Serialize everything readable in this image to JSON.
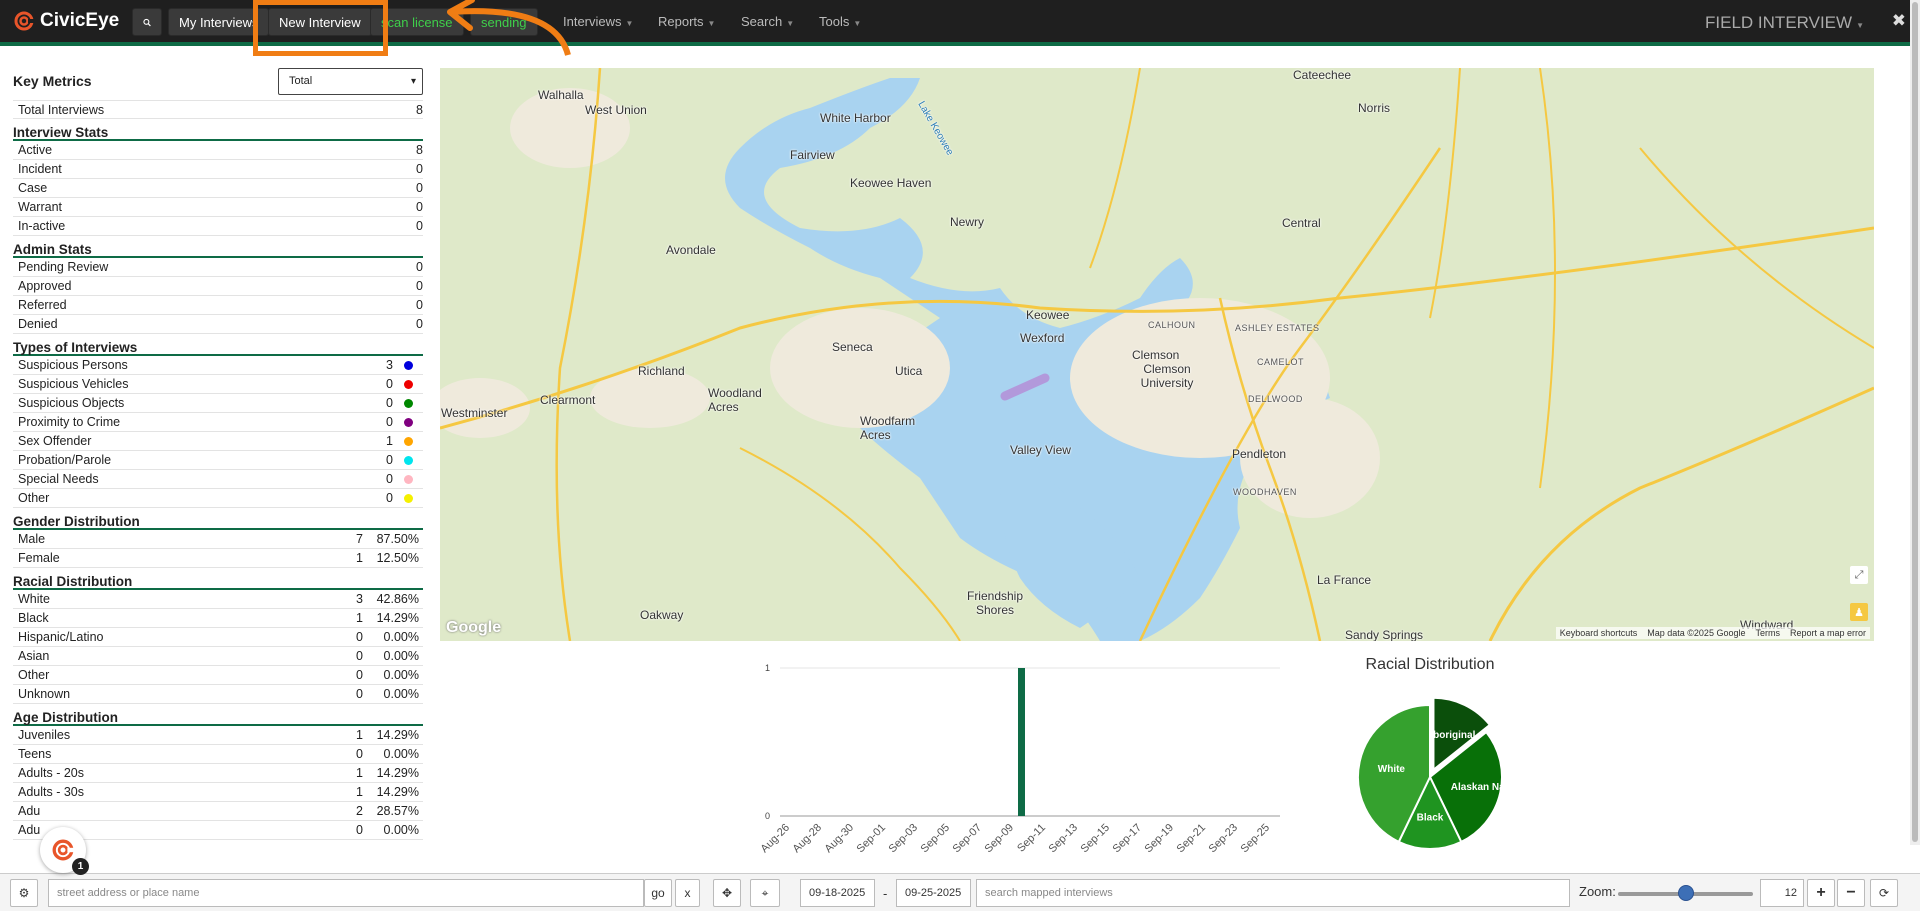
{
  "navbar": {
    "brand": "CivicEye",
    "buttons": [
      {
        "label": "My Interviews"
      },
      {
        "label": "New Interview"
      },
      {
        "label": "scan license"
      },
      {
        "label": "sending"
      }
    ],
    "menus": [
      {
        "label": "Interviews"
      },
      {
        "label": "Reports"
      },
      {
        "label": "Search"
      },
      {
        "label": "Tools"
      }
    ],
    "context": "FIELD INTERVIEW",
    "close": "✖",
    "accent": "#0e6b46",
    "highlight_color": "#f07d14"
  },
  "sidebar": {
    "key_metrics": {
      "title": "Key Metrics",
      "select_value": "Total",
      "total_label": "Total Interviews",
      "total_value": "8"
    },
    "interview_stats": {
      "title": "Interview Stats",
      "rows": [
        {
          "label": "Active",
          "value": "8"
        },
        {
          "label": "Incident",
          "value": "0"
        },
        {
          "label": "Case",
          "value": "0"
        },
        {
          "label": "Warrant",
          "value": "0"
        },
        {
          "label": "In-active",
          "value": "0"
        }
      ]
    },
    "admin_stats": {
      "title": "Admin Stats",
      "rows": [
        {
          "label": "Pending Review",
          "value": "0"
        },
        {
          "label": "Approved",
          "value": "0"
        },
        {
          "label": "Referred",
          "value": "0"
        },
        {
          "label": "Denied",
          "value": "0"
        }
      ]
    },
    "types": {
      "title": "Types of Interviews",
      "rows": [
        {
          "label": "Suspicious Persons",
          "value": "3",
          "color": "#0000dd"
        },
        {
          "label": "Suspicious Vehicles",
          "value": "0",
          "color": "#ee0000"
        },
        {
          "label": "Suspicious Objects",
          "value": "0",
          "color": "#008800"
        },
        {
          "label": "Proximity to Crime",
          "value": "0",
          "color": "#800080"
        },
        {
          "label": "Sex Offender",
          "value": "1",
          "color": "#ffa500"
        },
        {
          "label": "Probation/Parole",
          "value": "0",
          "color": "#00e5ee"
        },
        {
          "label": "Special Needs",
          "value": "0",
          "color": "#ffb6c1"
        },
        {
          "label": "Other",
          "value": "0",
          "color": "#f5f000"
        }
      ]
    },
    "gender": {
      "title": "Gender Distribution",
      "rows": [
        {
          "label": "Male",
          "value": "7",
          "pct": "87.50%"
        },
        {
          "label": "Female",
          "value": "1",
          "pct": "12.50%"
        }
      ]
    },
    "racial": {
      "title": "Racial Distribution",
      "rows": [
        {
          "label": "White",
          "value": "3",
          "pct": "42.86%"
        },
        {
          "label": "Black",
          "value": "1",
          "pct": "14.29%"
        },
        {
          "label": "Hispanic/Latino",
          "value": "0",
          "pct": "0.00%"
        },
        {
          "label": "Asian",
          "value": "0",
          "pct": "0.00%"
        },
        {
          "label": "Other",
          "value": "0",
          "pct": "0.00%"
        },
        {
          "label": "Unknown",
          "value": "0",
          "pct": "0.00%"
        }
      ]
    },
    "age": {
      "title": "Age Distribution",
      "rows": [
        {
          "label": "Juveniles",
          "value": "1",
          "pct": "14.29%"
        },
        {
          "label": "Teens",
          "value": "0",
          "pct": "0.00%"
        },
        {
          "label": "Adults - 20s",
          "value": "1",
          "pct": "14.29%"
        },
        {
          "label": "Adults - 30s",
          "value": "1",
          "pct": "14.29%"
        },
        {
          "label": "Adu",
          "value": "2",
          "pct": "28.57%"
        },
        {
          "label": "Adu",
          "value": "0",
          "pct": "0.00%"
        }
      ]
    }
  },
  "map": {
    "places": [
      {
        "name": "Walhalla"
      },
      {
        "name": "West Union"
      },
      {
        "name": "White Harbor"
      },
      {
        "name": "Lake Keowee"
      },
      {
        "name": "Fairview"
      },
      {
        "name": "Keowee Haven"
      },
      {
        "name": "Cateechee"
      },
      {
        "name": "Norris"
      },
      {
        "name": "Newry"
      },
      {
        "name": "Central"
      },
      {
        "name": "Avondale"
      },
      {
        "name": "Seneca"
      },
      {
        "name": "Keowee"
      },
      {
        "name": "Wexford"
      },
      {
        "name": "Utica"
      },
      {
        "name": "Clemson"
      },
      {
        "name": "Clemson University"
      },
      {
        "name": "Richland"
      },
      {
        "name": "Woodland Acres"
      },
      {
        "name": "Clearmont"
      },
      {
        "name": "Westminster"
      },
      {
        "name": "Woodfarm Acres"
      },
      {
        "name": "Valley View"
      },
      {
        "name": "Pendleton"
      },
      {
        "name": "Friendship Shores"
      },
      {
        "name": "Oakway"
      },
      {
        "name": "La France"
      },
      {
        "name": "Sandy Springs"
      },
      {
        "name": "Windward"
      }
    ],
    "small_labels": [
      "CALHOUN",
      "ASHLEY ESTATES",
      "CAMELOT",
      "DELLWOOD",
      "WOODHAVEN"
    ],
    "footer": [
      "Keyboard shortcuts",
      "Map data ©2025 Google",
      "Terms",
      "Report a map error"
    ],
    "logo": "Google"
  },
  "chart_data": [
    {
      "type": "bar",
      "categories": [
        "Aug-26",
        "Aug-28",
        "Aug-30",
        "Sep-01",
        "Sep-03",
        "Sep-05",
        "Sep-07",
        "Sep-09",
        "Sep-11",
        "Sep-13",
        "Sep-15",
        "Sep-17",
        "Sep-19",
        "Sep-21",
        "Sep-23",
        "Sep-25"
      ],
      "values": [
        0,
        0,
        0,
        0,
        0,
        0,
        0,
        1,
        0,
        0,
        0,
        0,
        0,
        0,
        0,
        0
      ],
      "ylim": [
        0,
        1
      ],
      "yticks": [
        "0",
        "1"
      ],
      "color": "#0e6b46"
    },
    {
      "type": "pie",
      "title": "Racial Distribution",
      "slices": [
        {
          "label": "Aboriginal",
          "value": 1,
          "color": "#0b4f0b"
        },
        {
          "label": "Alaskan Nat...",
          "value": 2,
          "color": "#087008"
        },
        {
          "label": "Black",
          "value": 1,
          "color": "#1f9420"
        },
        {
          "label": "White",
          "value": 3,
          "color": "#35a12e"
        }
      ]
    }
  ],
  "bottombar": {
    "address_placeholder": "street address or place name",
    "go": "go",
    "clear": "x",
    "date_from": "09-18-2025",
    "date_sep": "-",
    "date_to": "09-25-2025",
    "search_placeholder": "search mapped interviews",
    "zoom_label": "Zoom:",
    "zoom_value": "12",
    "zoom_fraction": 0.5
  },
  "chat": {
    "badge": "1"
  }
}
